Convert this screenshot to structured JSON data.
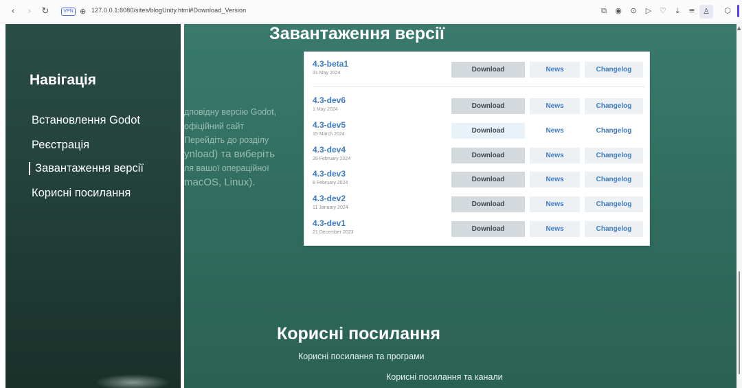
{
  "browser": {
    "vpn_label": "VPN",
    "url": "127.0.0.1:8080/sites/blogUnity.html#Download_Version"
  },
  "sidebar": {
    "title": "Навігація",
    "items": [
      {
        "label": "Встановлення Godot"
      },
      {
        "label": "Реєстрація"
      },
      {
        "label": "Завантаження версії"
      },
      {
        "label": "Корисні посилання"
      }
    ]
  },
  "main": {
    "download_title": "Завантаження версії",
    "background_text": {
      "line1": "дповідну версію Godot,",
      "line2": "офіційний сайт",
      "line3": "Перейдіть до розділу",
      "line4": "ynload) та виберіть",
      "line5": "ля вашої операційної",
      "line6": "macOS, Linux)."
    },
    "links_title": "Корисні посилання",
    "links_sub1": "Корисні посилання та програми",
    "links_sub2": "Корисні посилання та канали"
  },
  "versions": [
    {
      "name": "4.3-beta1",
      "date": "31 May 2024",
      "download": "Download",
      "news": "News",
      "changelog": "Changelog"
    },
    {
      "name": "4.3-dev6",
      "date": "1 May 2024",
      "download": "Download",
      "news": "News",
      "changelog": "Changelog"
    },
    {
      "name": "4.3-dev5",
      "date": "15 March 2024",
      "download": "Download",
      "news": "News",
      "changelog": "Changelog"
    },
    {
      "name": "4.3-dev4",
      "date": "29 February 2024",
      "download": "Download",
      "news": "News",
      "changelog": "Changelog"
    },
    {
      "name": "4.3-dev3",
      "date": "8 February 2024",
      "download": "Download",
      "news": "News",
      "changelog": "Changelog"
    },
    {
      "name": "4.3-dev2",
      "date": "11 January 2024",
      "download": "Download",
      "news": "News",
      "changelog": "Changelog"
    },
    {
      "name": "4.3-dev1",
      "date": "21 December 2023",
      "download": "Download",
      "news": "News",
      "changelog": "Changelog"
    }
  ],
  "colors": {
    "sidebar_bg": "#22413a",
    "main_bg": "#316e60",
    "link_blue": "#3d7bc4",
    "accent": "#5b3cff"
  }
}
